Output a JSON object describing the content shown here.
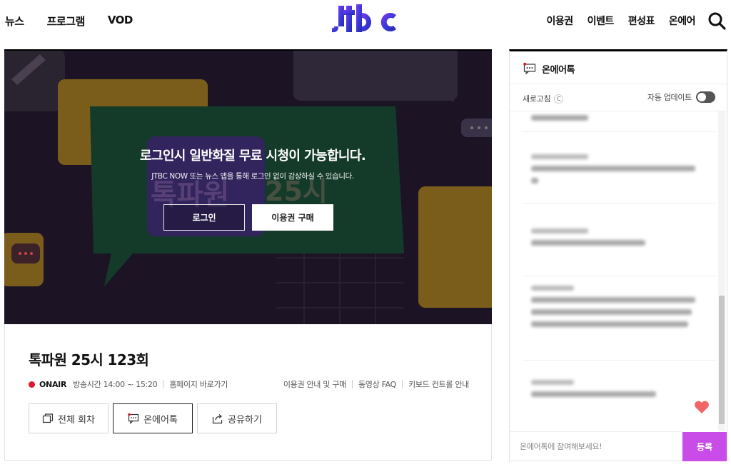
{
  "nav": {
    "left": [
      "뉴스",
      "프로그램",
      "VOD"
    ],
    "logo": "JTBC",
    "right": [
      "이용권",
      "이벤트",
      "편성표",
      "온에어"
    ]
  },
  "player": {
    "title": "로그인시 일반화질 무료 시청이 가능합니다.",
    "subtitle": "JTBC NOW 또는 뉴스 앱을 통해 로그인 없이 감상하실 수 있습니다.",
    "login_label": "로그인",
    "buy_label": "이용권 구매",
    "poster_text": "톡파원 25시"
  },
  "info": {
    "title": "톡파원 25시 123회",
    "onair": "ONAIR",
    "airtime": "방송시간 14:00 ~ 15:20",
    "homepage": "홈페이지 바로가기",
    "links": [
      "이용권 안내 및 구매",
      "동영상 FAQ",
      "키보드 컨트롤 안내"
    ],
    "buttons": {
      "all_episodes": "전체 회차",
      "onair_talk": "온에어톡",
      "share": "공유하기"
    }
  },
  "chat": {
    "title": "온에어톡",
    "refresh": "새로고침",
    "auto_update": "자동 업데이트",
    "auto_update_on": false,
    "input_placeholder": "온에어톡에 참여해보세요!",
    "submit": "등록",
    "submit_color": "#c94be8"
  },
  "colors": {
    "onair_dot": "#e0182d",
    "accent_purple": "#c94be8"
  }
}
